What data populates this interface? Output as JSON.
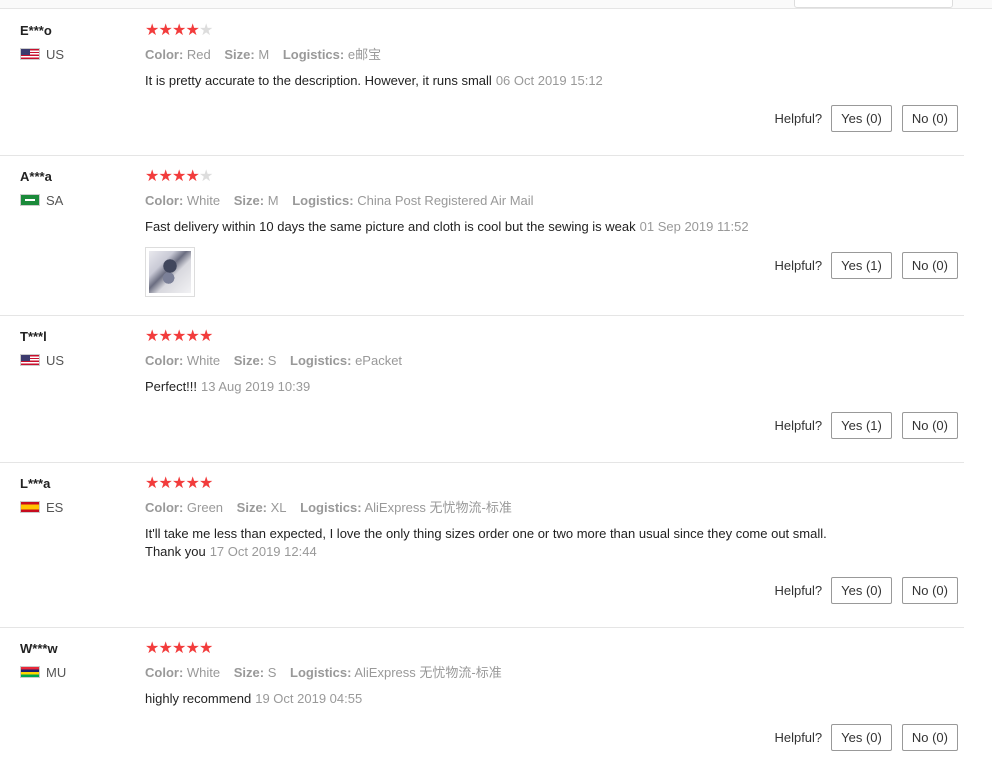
{
  "labels": {
    "color": "Color:",
    "size": "Size:",
    "logistics": "Logistics:",
    "helpful": "Helpful?"
  },
  "reviews": [
    {
      "user": "E***o",
      "country": "US",
      "stars": 4,
      "color": "Red",
      "size": "M",
      "logistics": "e邮宝",
      "text": "It is pretty accurate to the description. However, it runs small",
      "date": "06 Oct 2019 15:12",
      "yes": "Yes (0)",
      "no": "No (0)"
    },
    {
      "user": "A***a",
      "country": "SA",
      "stars": 4,
      "color": "White",
      "size": "M",
      "logistics": "China Post Registered Air Mail",
      "text": "Fast delivery within 10 days the same picture and cloth is cool but the sewing is weak",
      "date": "01 Sep 2019 11:52",
      "has_image": true,
      "yes": "Yes (1)",
      "no": "No (0)"
    },
    {
      "user": "T***l",
      "country": "US",
      "stars": 5,
      "color": "White",
      "size": "S",
      "logistics": "ePacket",
      "text": "Perfect!!!",
      "date": "13 Aug 2019 10:39",
      "yes": "Yes (1)",
      "no": "No (0)"
    },
    {
      "user": "L***a",
      "country": "ES",
      "stars": 5,
      "color": "Green",
      "size": "XL",
      "logistics": "AliExpress 无忧物流-标准",
      "text_line1": "It'll take me less than expected, I love the only thing sizes order one or two more than usual since they come out small.",
      "text": "Thank you",
      "date": "17 Oct 2019 12:44",
      "yes": "Yes (0)",
      "no": "No (0)"
    },
    {
      "user": "W***w",
      "country": "MU",
      "stars": 5,
      "color": "White",
      "size": "S",
      "logistics": "AliExpress 无忧物流-标准",
      "text": "highly recommend",
      "date": "19 Oct 2019 04:55",
      "yes": "Yes (0)",
      "no": "No (0)"
    }
  ]
}
